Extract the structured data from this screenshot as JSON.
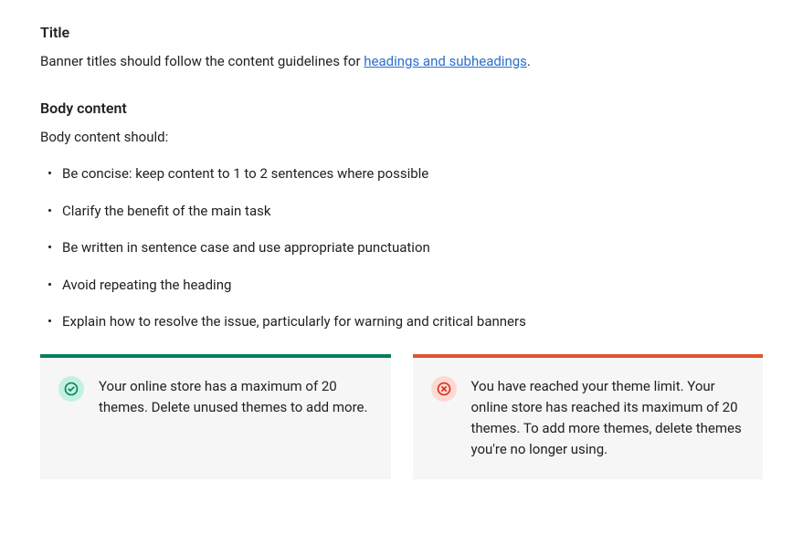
{
  "section1": {
    "heading": "Title",
    "text_before_link": "Banner titles should follow the content guidelines for ",
    "link_text": "headings and subheadings",
    "text_after_link": "."
  },
  "section2": {
    "heading": "Body content",
    "intro": "Body content should:",
    "bullets": [
      "Be concise: keep content to 1 to 2 sentences where possible",
      "Clarify the benefit of the main task",
      "Be written in sentence case and use appropriate punctuation",
      "Avoid repeating the heading",
      "Explain how to resolve the issue, particularly for warning and critical banners"
    ]
  },
  "examples": {
    "good": {
      "text": "Your online store has a maximum of 20 themes. Delete unused themes to add more."
    },
    "bad": {
      "text": "You have reached your theme limit. Your online store has reached its maximum of 20 themes. To add more themes, delete themes you're no longer using."
    }
  },
  "colors": {
    "good_border": "#008060",
    "bad_border": "#e2532f",
    "link": "#2c6ecb"
  }
}
